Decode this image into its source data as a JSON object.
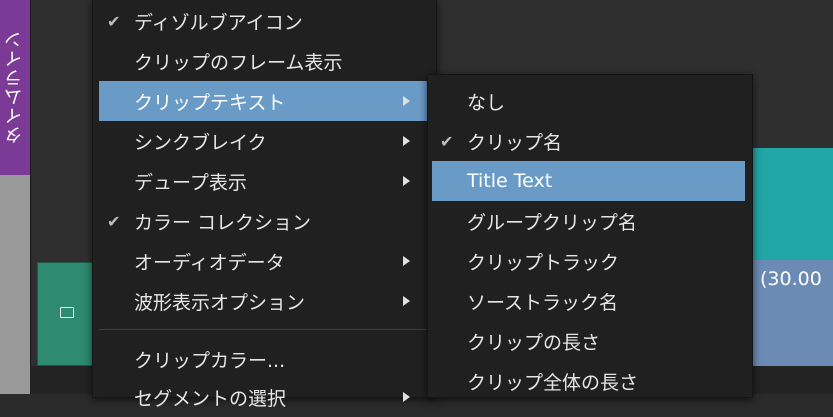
{
  "timeline_tab": {
    "label": "タイムライン",
    "color": "#7a3a96"
  },
  "clip": {
    "text": "(30.00"
  },
  "colors": {
    "highlight": "#6a9bc7",
    "menu_bg": "#202020",
    "teal_clip": "#22a6a6",
    "blue_clip": "#6b8bb5",
    "green_clip": "#2e8a70"
  },
  "main_menu": {
    "items": [
      {
        "label": "ディゾルブアイコン",
        "checked": true,
        "submenu": false,
        "highlighted": false
      },
      {
        "label": "クリップのフレーム表示",
        "checked": false,
        "submenu": false,
        "highlighted": false
      },
      {
        "label": "クリップテキスト",
        "checked": false,
        "submenu": true,
        "highlighted": true
      },
      {
        "label": "シンクブレイク",
        "checked": false,
        "submenu": true,
        "highlighted": false
      },
      {
        "label": "デュープ表示",
        "checked": false,
        "submenu": true,
        "highlighted": false
      },
      {
        "label": "カラー コレクション",
        "checked": true,
        "submenu": false,
        "highlighted": false
      },
      {
        "label": "オーディオデータ",
        "checked": false,
        "submenu": true,
        "highlighted": false
      },
      {
        "label": "波形表示オプション",
        "checked": false,
        "submenu": true,
        "highlighted": false
      },
      {
        "label": "クリップカラー...",
        "checked": false,
        "submenu": false,
        "highlighted": false
      },
      {
        "label": "セグメントの選択",
        "checked": false,
        "submenu": true,
        "highlighted": false
      }
    ]
  },
  "sub_menu": {
    "items": [
      {
        "label": "なし",
        "checked": false,
        "highlighted": false
      },
      {
        "label": "クリップ名",
        "checked": true,
        "highlighted": false
      },
      {
        "label": "Title Text",
        "checked": false,
        "highlighted": true
      },
      {
        "label": "グループクリップ名",
        "checked": false,
        "highlighted": false
      },
      {
        "label": "クリップトラック",
        "checked": false,
        "highlighted": false
      },
      {
        "label": "ソーストラック名",
        "checked": false,
        "highlighted": false
      },
      {
        "label": "クリップの長さ",
        "checked": false,
        "highlighted": false
      },
      {
        "label": "クリップ全体の長さ",
        "checked": false,
        "highlighted": false
      }
    ]
  }
}
